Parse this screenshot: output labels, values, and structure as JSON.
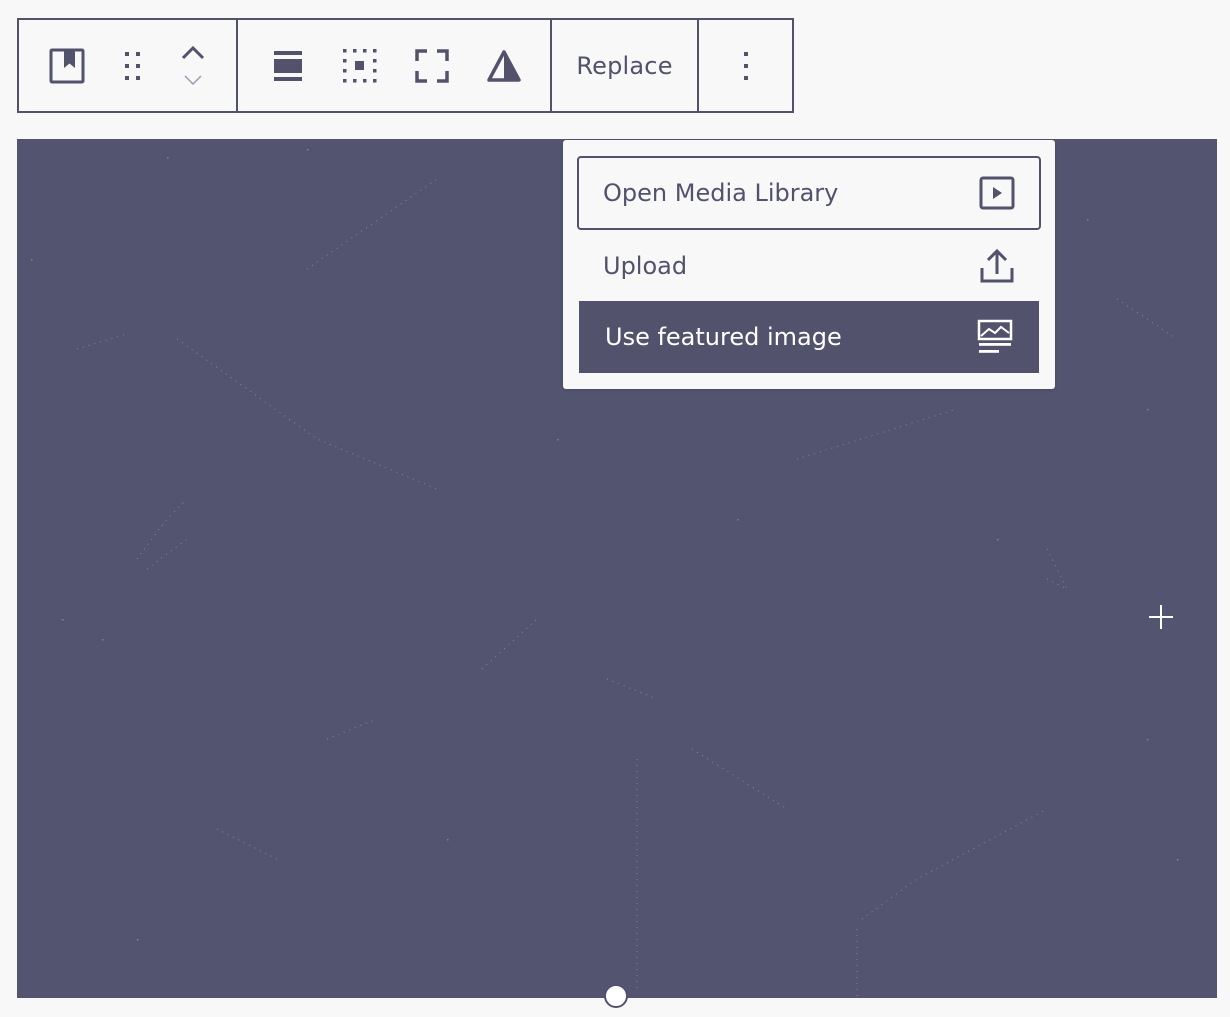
{
  "toolbar": {
    "groups": {
      "block": {
        "block_type_icon": "featured-image-icon",
        "drag_handle_icon": "drag-handle-icon",
        "move_up_icon": "chevron-up-icon",
        "move_down_icon": "chevron-down-icon"
      },
      "alignment": {
        "align_icon": "align-wide-icon",
        "focal_icon": "focal-point-icon",
        "fullscreen_icon": "fullscreen-icon",
        "duotone_icon": "duotone-filter-icon"
      }
    },
    "replace_label": "Replace",
    "more_options_icon": "more-vertical-icon"
  },
  "replace_menu": {
    "items": [
      {
        "label": "Open Media Library",
        "icon": "media-play-icon"
      },
      {
        "label": "Upload",
        "icon": "upload-icon"
      },
      {
        "label": "Use featured image",
        "icon": "featured-image-list-icon"
      }
    ]
  },
  "canvas": {
    "crosshair_icon": "crosshair-icon"
  },
  "colors": {
    "accent": "#53526c",
    "canvas": "#535470",
    "background": "#f7f8f7",
    "menu_highlight_text": "#ffffff"
  }
}
